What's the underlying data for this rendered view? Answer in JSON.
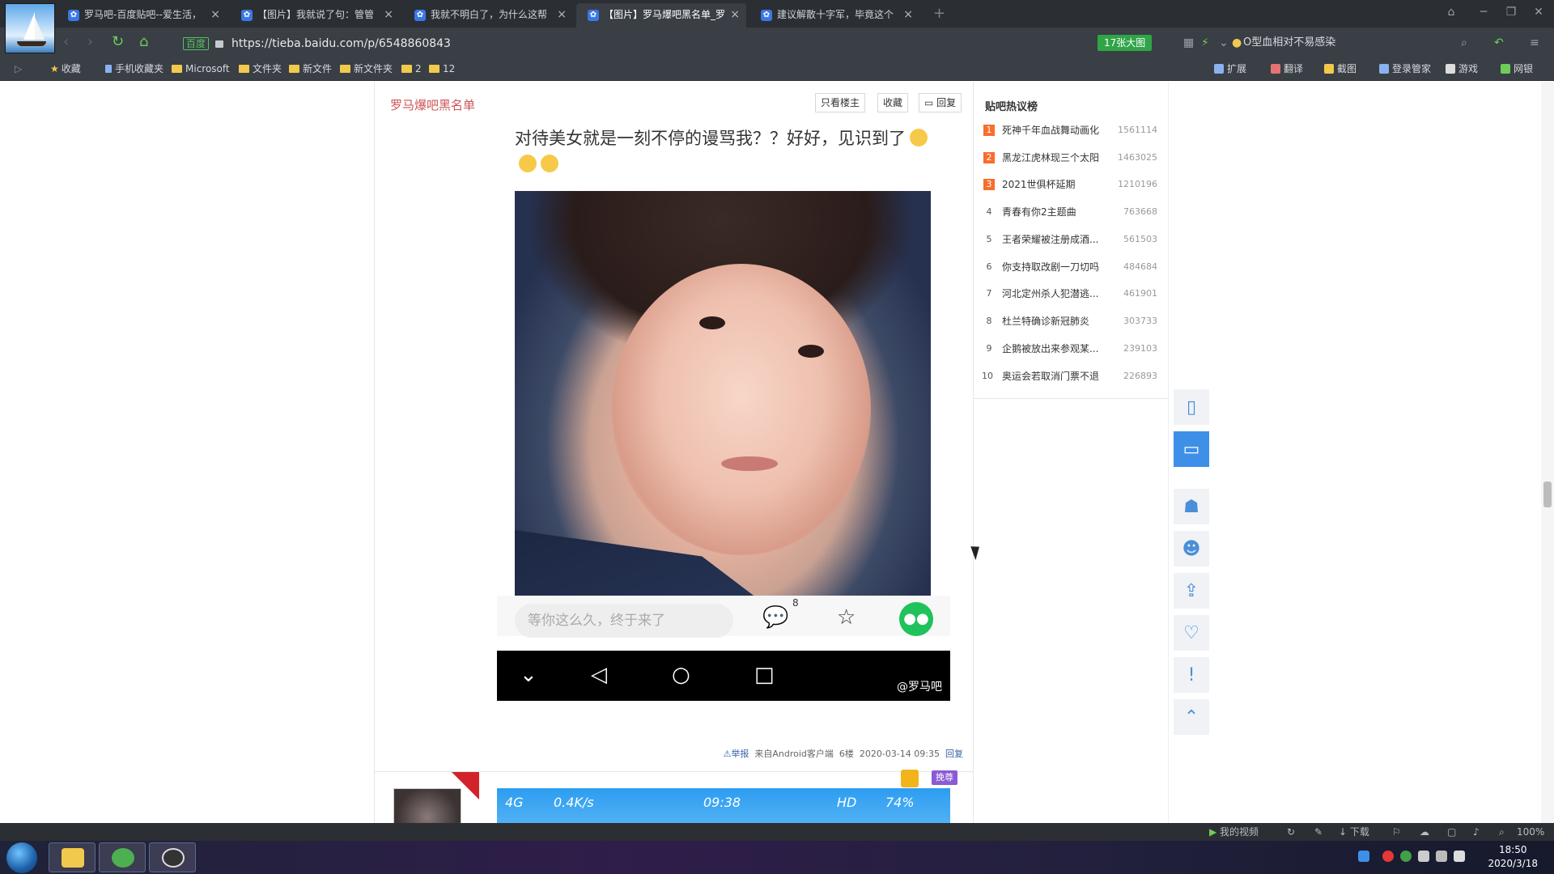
{
  "tabs": [
    {
      "title": "罗马吧-百度贴吧--爱生活，"
    },
    {
      "title": "【图片】我就说了句：管管"
    },
    {
      "title": "我就不明白了，为什么这帮"
    },
    {
      "title": "【图片】罗马爆吧黑名单_罗"
    },
    {
      "title": "建议解散十字军，毕竟这个"
    }
  ],
  "address": {
    "secure_label": "百度",
    "url": "https://tieba.baidu.com/p/6548860843",
    "bigpic_label": "17张大图",
    "search_hint": "O型血相对不易感染"
  },
  "bookmarks": [
    {
      "label": "收藏",
      "kind": "star"
    },
    {
      "label": "手机收藏夹",
      "kind": "phone"
    },
    {
      "label": "Microsoft",
      "kind": "folder"
    },
    {
      "label": "文件夹",
      "kind": "folder"
    },
    {
      "label": "新文件",
      "kind": "folder"
    },
    {
      "label": "新文件夹",
      "kind": "folder"
    },
    {
      "label": "2",
      "kind": "folder"
    },
    {
      "label": "12",
      "kind": "folder"
    }
  ],
  "bookmark_tools": [
    "扩展",
    "翻译",
    "截图",
    "登录管家",
    "游戏",
    "网银"
  ],
  "thread": {
    "title": "罗马爆吧黑名单",
    "btn_only_op": "只看楼主",
    "btn_collect": "收藏",
    "btn_reply": "回复"
  },
  "post": {
    "text": "对待美女就是一刻不停的谩骂我？？好好，见识到了",
    "reply_placeholder": "等你这么久，终于来了",
    "comment_count": "8",
    "watermark": "@罗马吧",
    "report": "举报",
    "source": "来自Android客户端",
    "floor": "6楼",
    "datetime": "2020-03-14 09:35",
    "reply": "回复"
  },
  "next_post": {
    "badge": "挽尊",
    "signal": "4G",
    "speed": "0.4K/s",
    "time": "09:38",
    "hd": "HD",
    "battery": "74%"
  },
  "hot": {
    "title": "贴吧热议榜",
    "items": [
      {
        "rank": "1",
        "name": "死神千年血战舞动画化",
        "count": "1561114"
      },
      {
        "rank": "2",
        "name": "黑龙江虎林现三个太阳",
        "count": "1463025"
      },
      {
        "rank": "3",
        "name": "2021世俱杯延期",
        "count": "1210196"
      },
      {
        "rank": "4",
        "name": "青春有你2主题曲",
        "count": "763668"
      },
      {
        "rank": "5",
        "name": "王者荣耀被注册成酒...",
        "count": "561503"
      },
      {
        "rank": "6",
        "name": "你支持取改剧一刀切吗",
        "count": "484684"
      },
      {
        "rank": "7",
        "name": "河北定州杀人犯潜逃...",
        "count": "461901"
      },
      {
        "rank": "8",
        "name": "杜兰特确诊新冠肺炎",
        "count": "303733"
      },
      {
        "rank": "9",
        "name": "企鹅被放出来参观某...",
        "count": "239103"
      },
      {
        "rank": "10",
        "name": "奥运会若取消门票不退",
        "count": "226893"
      }
    ]
  },
  "statusbar": {
    "my_video": "我的视频",
    "download": "下载",
    "zoom": "100%"
  },
  "taskbar": {
    "time": "18:50",
    "date": "2020/3/18"
  },
  "colors": {
    "accent_green": "#2fa548",
    "thread_title": "#cc5555",
    "hot_rank": "#f76e2d",
    "float_active": "#3e8fe8"
  }
}
